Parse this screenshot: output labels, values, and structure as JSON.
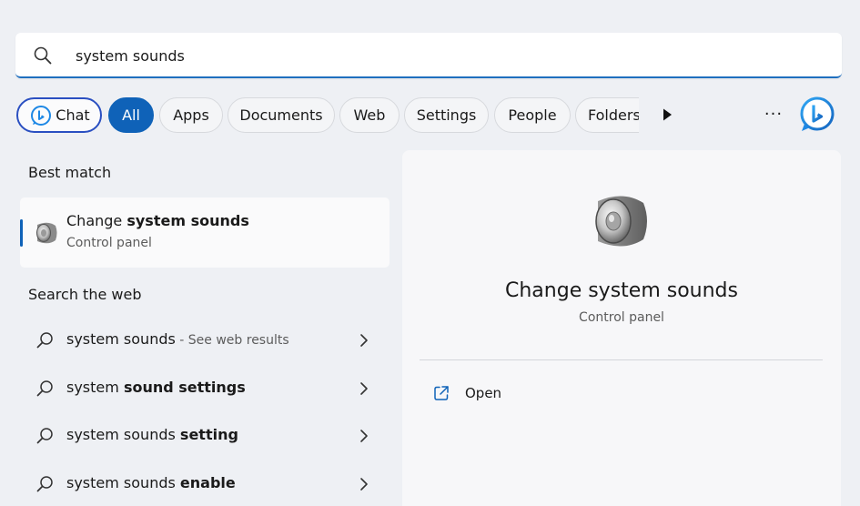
{
  "search": {
    "value": "system sounds",
    "placeholder": ""
  },
  "filters": {
    "chat_label": "Chat",
    "all_label": "All",
    "apps_label": "Apps",
    "documents_label": "Documents",
    "web_label": "Web",
    "settings_label": "Settings",
    "people_label": "People",
    "folders_label": "Folders",
    "more_label": "···"
  },
  "best_match": {
    "heading": "Best match",
    "title_prefix": "Change ",
    "title_bold": "system sounds",
    "subtitle": "Control panel"
  },
  "search_web": {
    "heading": "Search the web",
    "items": [
      {
        "plain": "system sounds",
        "bold": "",
        "suffix": " - See web results"
      },
      {
        "plain": "system ",
        "bold": "sound settings",
        "suffix": ""
      },
      {
        "plain": "system sounds ",
        "bold": "setting",
        "suffix": ""
      },
      {
        "plain": "system sounds ",
        "bold": "enable",
        "suffix": ""
      }
    ]
  },
  "detail": {
    "title": "Change system sounds",
    "subtitle": "Control panel",
    "actions": [
      {
        "label": "Open"
      }
    ]
  },
  "colors": {
    "accent": "#0f62b8",
    "chat_border": "#2a4fc1",
    "bing_blue": "#1e88e5"
  },
  "icons": [
    "search-icon",
    "bing-icon",
    "play-icon",
    "more-icon",
    "speaker-icon",
    "chevron-right-icon",
    "open-external-icon"
  ]
}
